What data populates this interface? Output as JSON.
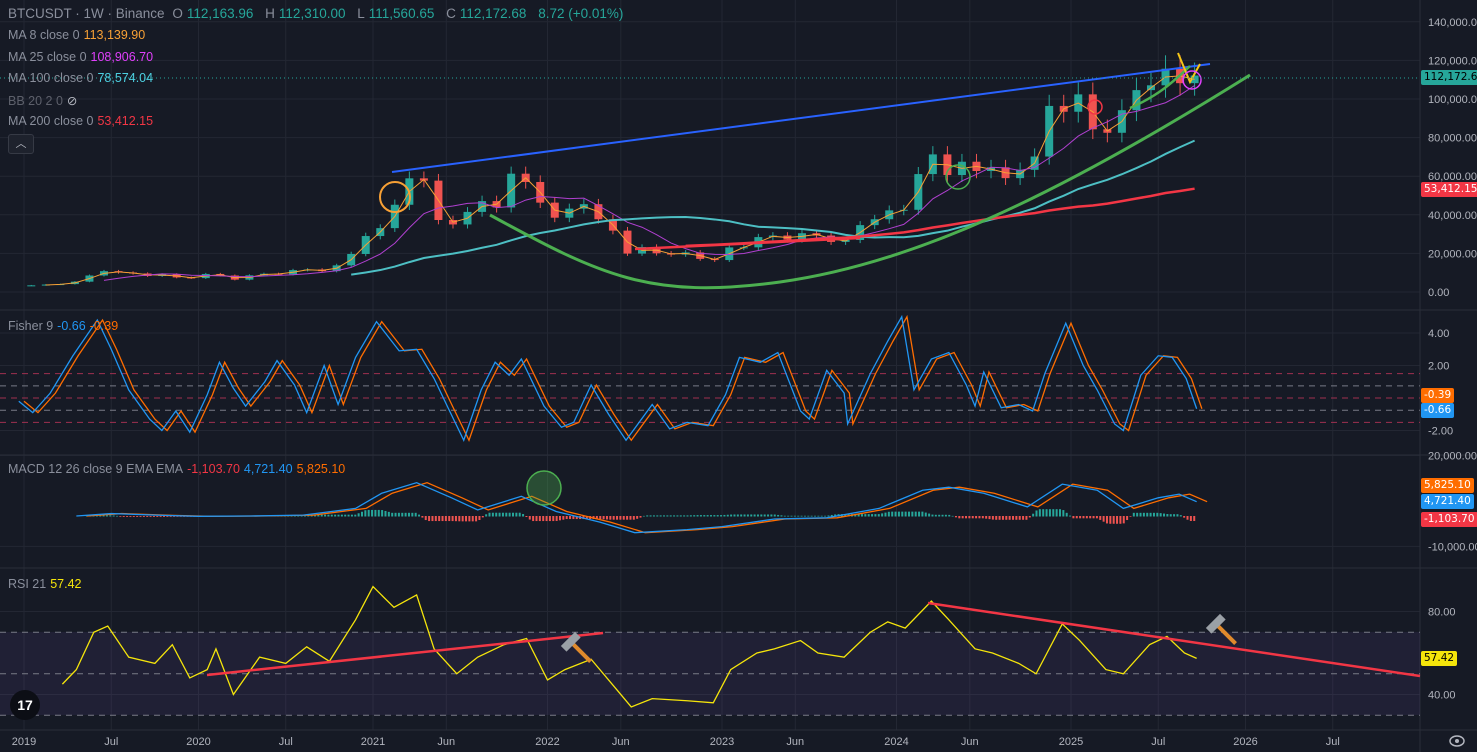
{
  "header": {
    "symbol": "BTCUSDT · 1W · Binance",
    "open_label": "O",
    "open": "112,163.96",
    "high_label": "H",
    "high": "112,310.00",
    "low_label": "L",
    "low": "111,560.65",
    "close_label": "C",
    "close": "112,172.68",
    "change": "8.72 (+0.01%)"
  },
  "indicators": {
    "ma8": {
      "label": "MA 8 close 0",
      "value": "113,139.90",
      "color": "#f7a035"
    },
    "ma25": {
      "label": "MA 25 close 0",
      "value": "108,906.70",
      "color": "#e040fb"
    },
    "ma100": {
      "label": "MA 100 close 0",
      "value": "78,574.04",
      "color": "#4dd0e1"
    },
    "bb": {
      "label": "BB 20 2 0"
    },
    "ma200": {
      "label": "MA 200 close 0",
      "value": "53,412.15",
      "color": "#f23645"
    },
    "fisher": {
      "label": "Fisher 9",
      "value1": "-0.66",
      "value2": "-0.39"
    },
    "macd": {
      "label": "MACD 12 26 close 9 EMA EMA",
      "hist": "-1,103.70",
      "macd": "4,721.40",
      "signal": "5,825.10"
    },
    "rsi": {
      "label": "RSI 21",
      "value": "57.42"
    }
  },
  "badges": {
    "price": "112,172.68",
    "ma200": "53,412.15",
    "fisher_trigger": "-0.39",
    "fisher": "-0.66",
    "macd_signal": "5,825.10",
    "macd": "4,721.40",
    "macd_hist": "-1,103.70",
    "rsi": "57.42"
  },
  "collapse_icon": "chevron-up-icon",
  "logo_text": "TV",
  "chart_data": {
    "type": "candlestick",
    "symbol": "BTCUSDT",
    "interval": "1W",
    "exchange": "Binance",
    "start": "2019-01",
    "step": "month",
    "closes": [
      3450,
      3850,
      4100,
      5350,
      8550,
      10800,
      10100,
      9600,
      8300,
      9150,
      7550,
      7200,
      9350,
      8550,
      6400,
      8650,
      9450,
      9150,
      11350,
      11650,
      10800,
      13800,
      19700,
      29000,
      33100,
      45200,
      58900,
      57700,
      37300,
      35000,
      41500,
      47100,
      43800,
      61300,
      57000,
      46300,
      38500,
      43200,
      45500,
      37700,
      31800,
      19900,
      23300,
      20050,
      19400,
      20500,
      17150,
      16550,
      23100,
      23150,
      28450,
      29250,
      27200,
      30450,
      29250,
      25950,
      26950,
      34650,
      37700,
      42300,
      42600,
      61100,
      71300,
      60600,
      67500,
      62700,
      64600,
      59000,
      63300,
      70200,
      96400,
      93400,
      102400,
      84300,
      82500,
      94200,
      104600,
      107100,
      115700,
      108200,
      112172.68
    ],
    "ma_periods_weeks": [
      8,
      25,
      100,
      200
    ],
    "price_ticks": [
      "0.00",
      "20,000.00",
      "40,000.00",
      "60,000.00",
      "80,000.00",
      "100,000.00",
      "120,000.00",
      "140,000.00"
    ],
    "price_ylim": [
      0,
      140000
    ],
    "time_ticks": [
      [
        "2019",
        2019.0
      ],
      [
        "Jul",
        2019.5
      ],
      [
        "2020",
        2020.0
      ],
      [
        "Jul",
        2020.5
      ],
      [
        "2021",
        2021.0
      ],
      [
        "Jun",
        2021.42
      ],
      [
        "2022",
        2022.0
      ],
      [
        "Jun",
        2022.42
      ],
      [
        "2023",
        2023.0
      ],
      [
        "Jun",
        2023.42
      ],
      [
        "2024",
        2024.0
      ],
      [
        "Jun",
        2024.42
      ],
      [
        "2025",
        2025.0
      ],
      [
        "Jul",
        2025.5
      ],
      [
        "2026",
        2026.0
      ],
      [
        "Jul",
        2026.5
      ]
    ],
    "fisher": {
      "ticks": [
        "4.00",
        "2.00",
        "-2.00"
      ],
      "levels": [
        1.5,
        0.75,
        0,
        -0.75,
        -1.5
      ],
      "points": [
        [
          2018.97,
          -0.2
        ],
        [
          2019.05,
          -0.9
        ],
        [
          2019.15,
          0.3
        ],
        [
          2019.28,
          2.6
        ],
        [
          2019.42,
          4.8
        ],
        [
          2019.5,
          3.0
        ],
        [
          2019.6,
          0.5
        ],
        [
          2019.72,
          -1.3
        ],
        [
          2019.79,
          -2.0
        ],
        [
          2019.87,
          -0.8
        ],
        [
          2019.95,
          -2.1
        ],
        [
          2020.05,
          0.2
        ],
        [
          2020.12,
          2.2
        ],
        [
          2020.2,
          0.6
        ],
        [
          2020.27,
          -0.5
        ],
        [
          2020.38,
          1.0
        ],
        [
          2020.45,
          2.3
        ],
        [
          2020.55,
          0.8
        ],
        [
          2020.62,
          -0.9
        ],
        [
          2020.72,
          2.0
        ],
        [
          2020.8,
          -0.4
        ],
        [
          2020.9,
          2.5
        ],
        [
          2021.02,
          4.7
        ],
        [
          2021.15,
          2.9
        ],
        [
          2021.25,
          3.0
        ],
        [
          2021.35,
          1.2
        ],
        [
          2021.43,
          -0.6
        ],
        [
          2021.52,
          -2.6
        ],
        [
          2021.62,
          0.5
        ],
        [
          2021.7,
          2.2
        ],
        [
          2021.78,
          1.4
        ],
        [
          2021.85,
          2.4
        ],
        [
          2021.98,
          -0.5
        ],
        [
          2022.08,
          -1.8
        ],
        [
          2022.15,
          -1.5
        ],
        [
          2022.25,
          0.8
        ],
        [
          2022.35,
          -1.0
        ],
        [
          2022.45,
          -2.6
        ],
        [
          2022.6,
          -0.4
        ],
        [
          2022.7,
          -1.9
        ],
        [
          2022.8,
          -1.5
        ],
        [
          2022.92,
          -1.7
        ],
        [
          2023.02,
          0.2
        ],
        [
          2023.1,
          2.5
        ],
        [
          2023.22,
          2.2
        ],
        [
          2023.32,
          2.8
        ],
        [
          2023.45,
          -0.8
        ],
        [
          2023.5,
          -1.3
        ],
        [
          2023.6,
          1.7
        ],
        [
          2023.7,
          0.3
        ],
        [
          2023.72,
          -1.6
        ],
        [
          2023.85,
          1.5
        ],
        [
          2023.95,
          3.5
        ],
        [
          2024.03,
          5.0
        ],
        [
          2024.1,
          0.5
        ],
        [
          2024.2,
          2.4
        ],
        [
          2024.3,
          2.8
        ],
        [
          2024.4,
          0.8
        ],
        [
          2024.45,
          -0.5
        ],
        [
          2024.5,
          1.6
        ],
        [
          2024.6,
          -0.6
        ],
        [
          2024.7,
          -0.4
        ],
        [
          2024.78,
          -0.8
        ],
        [
          2024.85,
          1.5
        ],
        [
          2024.97,
          4.6
        ],
        [
          2025.07,
          2.0
        ],
        [
          2025.15,
          0.5
        ],
        [
          2025.25,
          -1.6
        ],
        [
          2025.3,
          -2.0
        ],
        [
          2025.4,
          1.4
        ],
        [
          2025.5,
          2.6
        ],
        [
          2025.58,
          2.5
        ],
        [
          2025.66,
          1.2
        ],
        [
          2025.72,
          -0.66
        ]
      ]
    },
    "macd": {
      "ticks": [
        "20,000.00",
        "-10,000.00"
      ],
      "points": [
        [
          2019.3,
          0
        ],
        [
          2019.5,
          800
        ],
        [
          2019.8,
          200
        ],
        [
          2020.0,
          -100
        ],
        [
          2020.3,
          0
        ],
        [
          2020.6,
          300
        ],
        [
          2020.9,
          2500
        ],
        [
          2021.05,
          7500
        ],
        [
          2021.25,
          11000
        ],
        [
          2021.45,
          6000
        ],
        [
          2021.6,
          2000
        ],
        [
          2021.85,
          6500
        ],
        [
          2022.05,
          1500
        ],
        [
          2022.3,
          -2000
        ],
        [
          2022.5,
          -5500
        ],
        [
          2022.8,
          -4500
        ],
        [
          2023.0,
          -3500
        ],
        [
          2023.3,
          -1000
        ],
        [
          2023.6,
          -600
        ],
        [
          2023.9,
          2500
        ],
        [
          2024.15,
          8500
        ],
        [
          2024.3,
          9500
        ],
        [
          2024.5,
          7500
        ],
        [
          2024.75,
          3000
        ],
        [
          2024.95,
          10500
        ],
        [
          2025.15,
          8500
        ],
        [
          2025.3,
          2500
        ],
        [
          2025.5,
          6000
        ],
        [
          2025.62,
          7200
        ],
        [
          2025.72,
          4721.4
        ]
      ]
    },
    "rsi": {
      "ticks": [
        "80.00",
        "40.00"
      ],
      "levels": [
        70,
        50,
        30
      ],
      "points": [
        [
          2019.22,
          45
        ],
        [
          2019.3,
          52
        ],
        [
          2019.4,
          70
        ],
        [
          2019.48,
          73
        ],
        [
          2019.6,
          58
        ],
        [
          2019.75,
          55
        ],
        [
          2019.85,
          64
        ],
        [
          2019.95,
          48
        ],
        [
          2020.05,
          52
        ],
        [
          2020.1,
          62
        ],
        [
          2020.2,
          40
        ],
        [
          2020.35,
          58
        ],
        [
          2020.5,
          55
        ],
        [
          2020.62,
          63
        ],
        [
          2020.75,
          56
        ],
        [
          2020.9,
          76
        ],
        [
          2021.0,
          92
        ],
        [
          2021.12,
          82
        ],
        [
          2021.25,
          88
        ],
        [
          2021.35,
          62
        ],
        [
          2021.48,
          50
        ],
        [
          2021.6,
          58
        ],
        [
          2021.75,
          64
        ],
        [
          2021.88,
          67
        ],
        [
          2022.0,
          47
        ],
        [
          2022.1,
          52
        ],
        [
          2022.25,
          57
        ],
        [
          2022.4,
          42
        ],
        [
          2022.48,
          34
        ],
        [
          2022.6,
          38
        ],
        [
          2022.8,
          37
        ],
        [
          2022.95,
          36
        ],
        [
          2023.05,
          52
        ],
        [
          2023.2,
          60
        ],
        [
          2023.3,
          62
        ],
        [
          2023.45,
          66
        ],
        [
          2023.55,
          60
        ],
        [
          2023.7,
          58
        ],
        [
          2023.85,
          70
        ],
        [
          2023.95,
          75
        ],
        [
          2024.05,
          72
        ],
        [
          2024.2,
          85
        ],
        [
          2024.3,
          76
        ],
        [
          2024.45,
          62
        ],
        [
          2024.55,
          60
        ],
        [
          2024.7,
          55
        ],
        [
          2024.8,
          50
        ],
        [
          2024.95,
          74
        ],
        [
          2025.05,
          66
        ],
        [
          2025.2,
          52
        ],
        [
          2025.3,
          50
        ],
        [
          2025.45,
          64
        ],
        [
          2025.55,
          68
        ],
        [
          2025.65,
          60
        ],
        [
          2025.72,
          57.42
        ]
      ]
    }
  }
}
